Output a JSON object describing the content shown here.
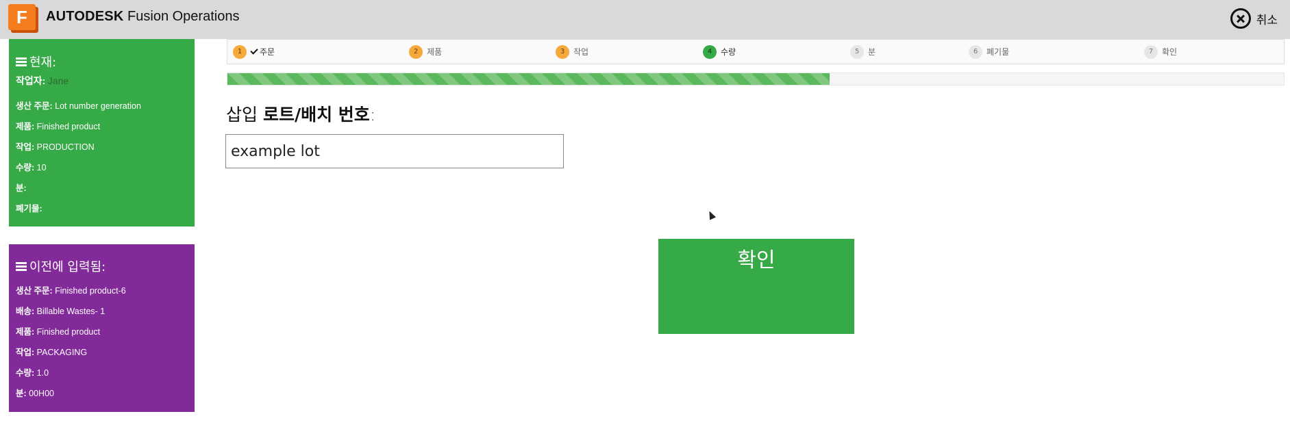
{
  "header": {
    "logo_letter": "F",
    "brand_bold": "AUTODESK",
    "brand_product": "Fusion Operations",
    "cancel_label": "취소"
  },
  "current_panel": {
    "title": "현재:",
    "operator_label": "작업자:",
    "operator_name": "Jane",
    "rows": [
      {
        "label": "생산 주문:",
        "value": "Lot number generation"
      },
      {
        "label": "제품:",
        "value": "Finished product"
      },
      {
        "label": "작업:",
        "value": "PRODUCTION"
      },
      {
        "label": "수량:",
        "value": "10"
      },
      {
        "label": "분:",
        "value": ""
      },
      {
        "label": "폐기물:",
        "value": ""
      }
    ]
  },
  "previous_panel": {
    "title": "이전에 입력됨:",
    "rows": [
      {
        "label": "생산 주문:",
        "value": "Finished product-6"
      },
      {
        "label": "배송:",
        "value": "Billable Wastes- 1"
      },
      {
        "label": "제품:",
        "value": "Finished product"
      },
      {
        "label": "작업:",
        "value": "PACKAGING"
      },
      {
        "label": "수량:",
        "value": "1.0"
      },
      {
        "label": "분:",
        "value": "00H00"
      }
    ]
  },
  "steps": [
    {
      "num": "1",
      "label": "주문",
      "state": "done",
      "checked": true
    },
    {
      "num": "2",
      "label": "제품",
      "state": "done"
    },
    {
      "num": "3",
      "label": "작업",
      "state": "done"
    },
    {
      "num": "4",
      "label": "수량",
      "state": "active"
    },
    {
      "num": "5",
      "label": "분",
      "state": "todo"
    },
    {
      "num": "6",
      "label": "폐기물",
      "state": "todo"
    },
    {
      "num": "7",
      "label": "확인",
      "state": "todo"
    }
  ],
  "progress_fraction": 0.57,
  "prompt": {
    "prefix": "삽입",
    "bold": "로트/배치 번호",
    "suffix": ":"
  },
  "lot_input": {
    "value": "example lot"
  },
  "confirm_label": "확인",
  "colors": {
    "current_panel": "#37aa48",
    "previous_panel": "#822a9a",
    "step_done": "#f6a93b",
    "step_active": "#37aa48",
    "progress": "#5cb85c",
    "brand_orange": "#f47d1f"
  }
}
